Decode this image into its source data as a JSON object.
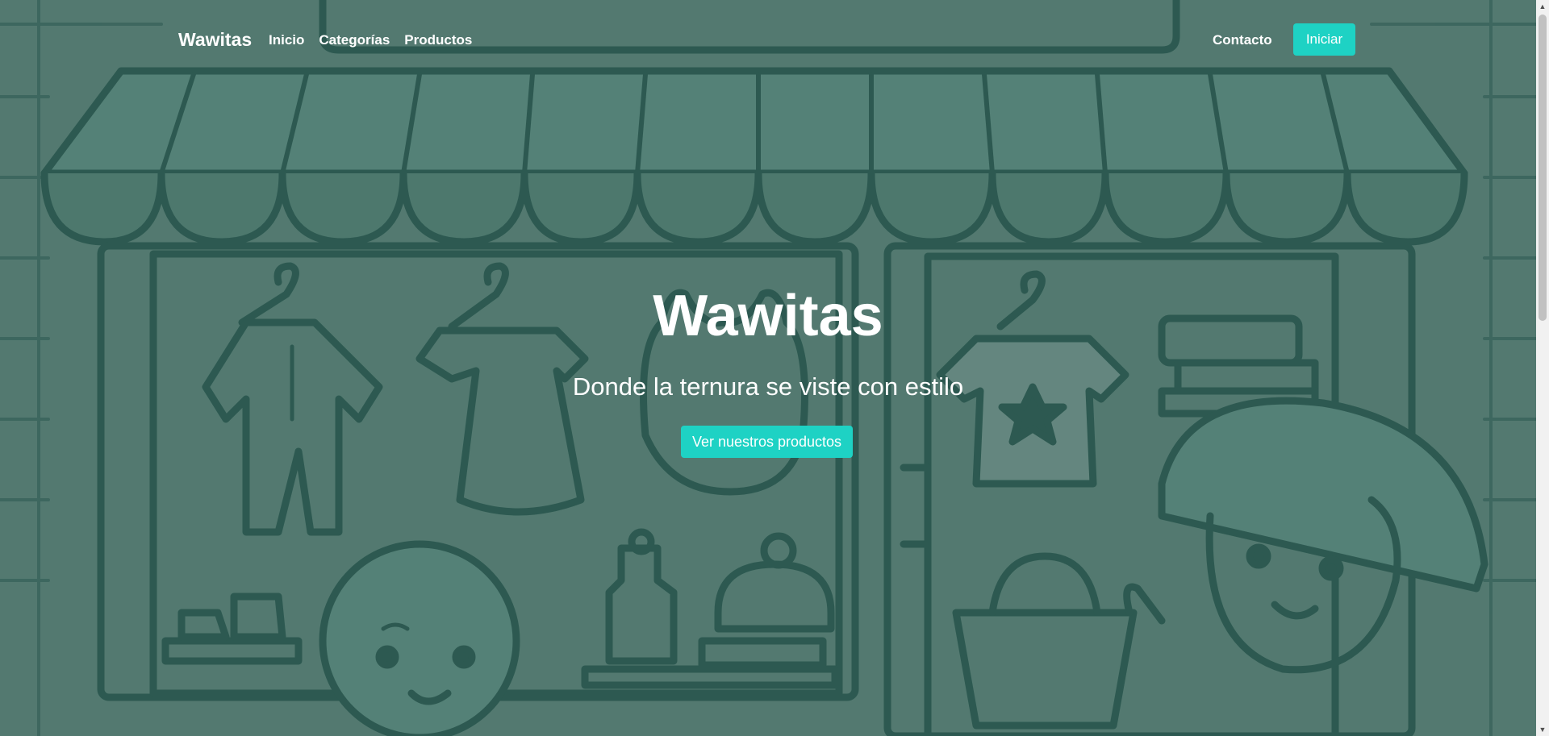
{
  "navbar": {
    "brand": "Wawitas",
    "links": [
      {
        "label": "Inicio"
      },
      {
        "label": "Categorías"
      },
      {
        "label": "Productos"
      }
    ],
    "contact": "Contacto",
    "login": "Iniciar"
  },
  "hero": {
    "title": "Wawitas",
    "subtitle": "Donde la ternura se viste con estilo",
    "cta": "Ver nuestros productos"
  },
  "colors": {
    "accent": "#1ed2c4",
    "overlay": "#5d8178",
    "line": "#2f5a52"
  },
  "icons": {
    "scroll_up": "chevron-up-icon",
    "scroll_down": "chevron-down-icon"
  }
}
